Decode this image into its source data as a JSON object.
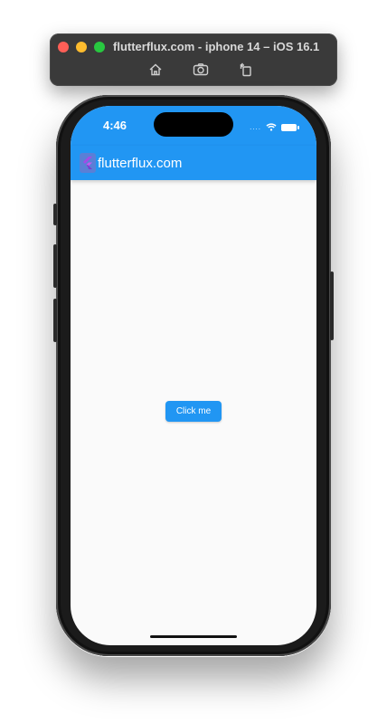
{
  "simulator": {
    "title": "flutterflux.com - iphone 14 – iOS 16.1",
    "toolbar_icons": [
      "home-icon",
      "screenshot-icon",
      "rotate-icon"
    ]
  },
  "status_bar": {
    "time": "4:46",
    "signal": "....",
    "icons": [
      "wifi-icon",
      "battery-icon"
    ]
  },
  "app_bar": {
    "title": "flutterflux.com",
    "logo_icon": "flutter-logo-icon",
    "color": "#2196f3"
  },
  "content": {
    "button_label": "Click me"
  },
  "colors": {
    "primary": "#2196f3",
    "background": "#fafafa"
  }
}
